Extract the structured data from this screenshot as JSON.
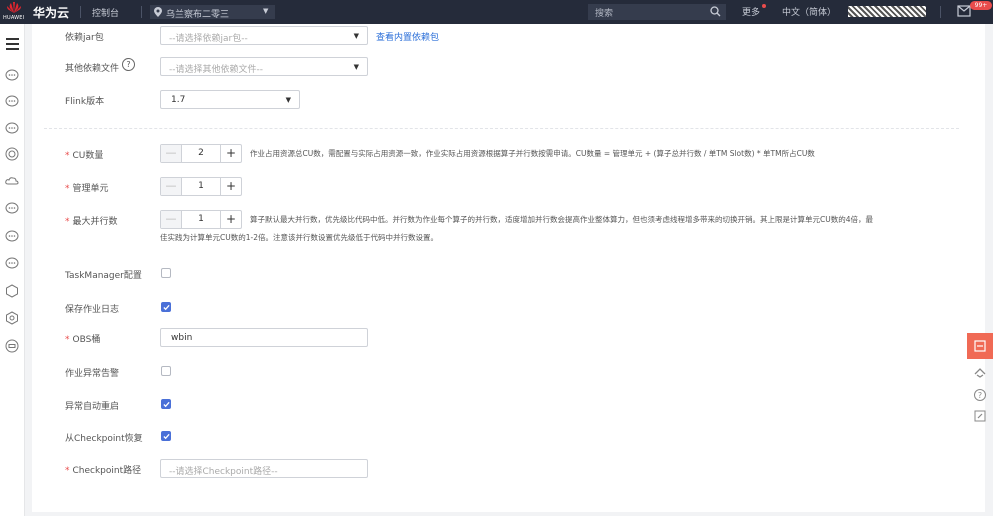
{
  "topbar": {
    "logo_text": "HUAWEI",
    "brand": "华为云",
    "console": "控制台",
    "region": "乌兰察布二零三",
    "search_placeholder": "搜索",
    "more": "更多",
    "language": "中文（简体）",
    "mail_badge": "99+",
    "colors": {
      "bar": "#252b3a",
      "accent": "#e94c4c"
    }
  },
  "form": {
    "jar": {
      "label": "依赖jar包",
      "placeholder": "--请选择依赖jar包--",
      "link": "查看内置依赖包"
    },
    "other_files": {
      "label": "其他依赖文件",
      "placeholder": "--请选择其他依赖文件--"
    },
    "flink_version": {
      "label": "Flink版本",
      "value": "1.7"
    },
    "cu": {
      "label": "CU数量",
      "value": "2",
      "desc": "作业占用资源总CU数，需配置与实际占用资源一致，作业实际占用资源根据算子并行数按需申请。CU数量 = 管理单元 + (算子总并行数 / 单TM Slot数) * 单TM所占CU数"
    },
    "mgmt_unit": {
      "label": "管理单元",
      "value": "1"
    },
    "max_parallel": {
      "label": "最大并行数",
      "value": "1",
      "desc_line1": "算子默认最大并行数，优先级比代码中低。并行数为作业每个算子的并行数，适度增加并行数会提高作业整体算力，但也须考虑线程增多带来的切换开销。其上限是计算单元CU数的4倍，最",
      "desc_line2": "佳实践为计算单元CU数的1-2倍。注意该并行数设置优先级低于代码中并行数设置。"
    },
    "taskmanager": {
      "label": "TaskManager配置",
      "checked": false
    },
    "save_log": {
      "label": "保存作业日志",
      "checked": true
    },
    "obs": {
      "label": "OBS桶",
      "value": "wbin"
    },
    "alarm": {
      "label": "作业异常告警",
      "checked": false
    },
    "auto_restart": {
      "label": "异常自动重启",
      "checked": true
    },
    "checkpoint_restore": {
      "label": "从Checkpoint恢复",
      "checked": true
    },
    "checkpoint_path": {
      "label": "Checkpoint路径",
      "placeholder": "--请选择Checkpoint路径--"
    },
    "colors": {
      "required": "#e94c4c",
      "link": "#2a6ed8",
      "checkbox": "#4a70d8"
    }
  }
}
